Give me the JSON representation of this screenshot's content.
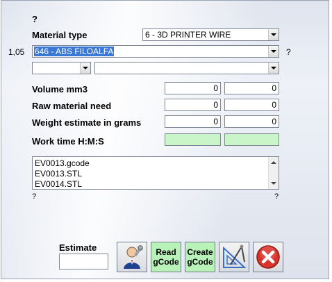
{
  "top_help": "?",
  "material_type": {
    "label": "Material type",
    "value": "6 - 3D PRINTER WIRE"
  },
  "material": {
    "left_value": "1,05",
    "value": "646 - ABS FILOALFA",
    "help": "?"
  },
  "rows": [
    {
      "label": "Volume mm3",
      "v1": "0",
      "v2": "0"
    },
    {
      "label": "Raw material need",
      "v1": "0",
      "v2": "0"
    },
    {
      "label": "Weight estimate in grams",
      "v1": "0",
      "v2": "0"
    }
  ],
  "work_time": {
    "label": "Work time H:M:S",
    "v1": "",
    "v2": ""
  },
  "files": [
    "EV0013.gcode",
    "EV0013.STL",
    "EV0014.STL"
  ],
  "bottom_help_left": "?",
  "bottom_help_right": "?",
  "estimate": {
    "label": "Estimate",
    "value": ""
  },
  "buttons": {
    "read_gcode": "Read\ngCode",
    "create_gcode": "Create\ngCode"
  },
  "icons": {
    "settings": "user-wrench-icon",
    "drafting": "drafting-compass-icon",
    "close": "close-icon"
  },
  "colors": {
    "accent": "#3a78d8",
    "green_field": "#c9f5c9",
    "close_red": "#d9342b"
  }
}
